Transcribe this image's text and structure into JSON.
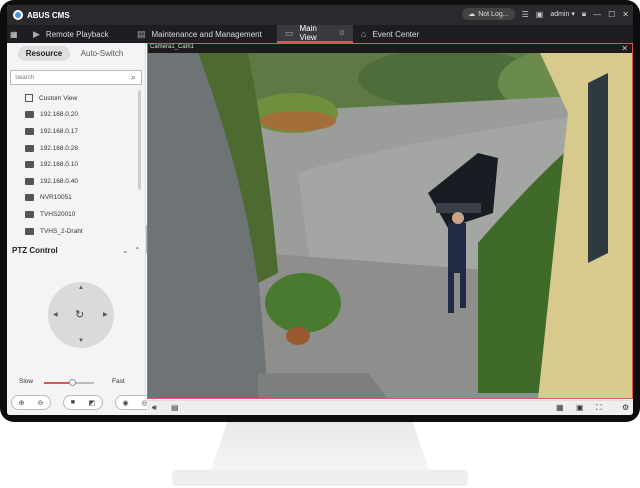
{
  "app": {
    "name": "ABUS CMS",
    "login_status": "Not Log...",
    "user": "admin"
  },
  "tabs": [
    {
      "label": "Remote Playback",
      "icon": "playback-icon"
    },
    {
      "label": "Maintenance and Management",
      "icon": "maintenance-icon"
    },
    {
      "label": "Main View",
      "icon": "main-view-icon",
      "active": true
    },
    {
      "label": "Event Center",
      "icon": "event-icon"
    }
  ],
  "left_panel": {
    "segments": {
      "resource": "Resource",
      "auto_switch": "Auto-Switch"
    },
    "search_placeholder": "Search",
    "tree": [
      {
        "label": "Custom View",
        "icon": "custom-view-icon"
      },
      {
        "label": "192.168.0.20",
        "icon": "device-icon"
      },
      {
        "label": "192.168.0.17",
        "icon": "device-icon"
      },
      {
        "label": "192.168.0.28",
        "icon": "device-icon"
      },
      {
        "label": "192.168.0.10",
        "icon": "device-icon"
      },
      {
        "label": "192.168.0.40",
        "icon": "device-icon"
      },
      {
        "label": "NVR10051",
        "icon": "device-icon"
      },
      {
        "label": "TVHS20010",
        "icon": "device-icon"
      },
      {
        "label": "TVHS_2-Draht",
        "icon": "device-icon"
      }
    ],
    "ptz": {
      "title": "PTZ Control",
      "speed_slow": "Slow",
      "speed_fast": "Fast",
      "speed_level": 0.55
    }
  },
  "video": {
    "camera_name": "Camera1_Cam1"
  },
  "colors": {
    "accent": "#e0525c",
    "titlebar": "#2a2a2e",
    "tabbar": "#1e1e22"
  }
}
